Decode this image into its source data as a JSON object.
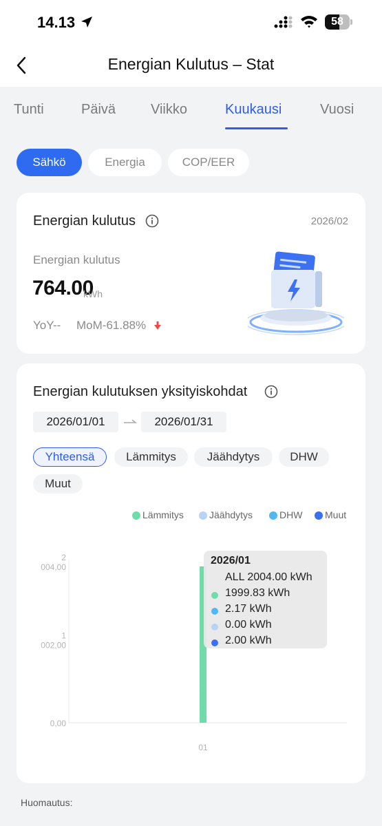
{
  "status_bar": {
    "time": "14.13",
    "battery": "58",
    "battery_level": 0.58
  },
  "navbar": {
    "title": "Energian Kulutus – Stat"
  },
  "tabs": [
    {
      "label": "Tunti",
      "active": false
    },
    {
      "label": "Päivä",
      "active": false
    },
    {
      "label": "Viikko",
      "active": false
    },
    {
      "label": "Kuukausi",
      "active": true
    },
    {
      "label": "Vuosi",
      "active": false
    }
  ],
  "type_chips": [
    {
      "label": "Sähkö",
      "active": true
    },
    {
      "label": "Energia",
      "active": false
    },
    {
      "label": "COP/EER",
      "active": false
    }
  ],
  "summary": {
    "title": "Energian kulutus",
    "date": "2026/02",
    "label": "Energian kulutus",
    "value": "764.00",
    "unit": "kWh",
    "yoy": "YoY--",
    "mom": "MoM-61.88%"
  },
  "details": {
    "title": "Energian kulutuksen yksityiskohdat",
    "date_start": "2026/01/01",
    "date_end": "2026/01/31",
    "filters": [
      {
        "label": "Yhteensä",
        "active": true
      },
      {
        "label": "Lämmitys",
        "active": false
      },
      {
        "label": "Jäähdytys",
        "active": false
      },
      {
        "label": "DHW",
        "active": false
      },
      {
        "label": "Muut",
        "active": false
      }
    ]
  },
  "colors": {
    "accent": "#2f5bea",
    "heating": "#6fdcaa",
    "cooling": "#b9d3f7",
    "dhw": "#4fb8f5",
    "other": "#3b6ff0"
  },
  "chart_data": {
    "type": "bar",
    "categories": [
      "01"
    ],
    "series": [
      {
        "name": "Lämmitys",
        "values": [
          1999.83
        ]
      },
      {
        "name": "Jäähdytys",
        "values": [
          0.0
        ]
      },
      {
        "name": "DHW",
        "values": [
          2.17
        ]
      },
      {
        "name": "Muut",
        "values": [
          2.0
        ]
      }
    ],
    "y_ticks": [
      "0,00",
      "1\n002,00",
      "2\n004,00"
    ],
    "ylim": [
      0,
      2004
    ],
    "legend_position": "top-right",
    "tooltip": {
      "title": "2026/01",
      "total": "ALL 2004.00 kWh",
      "rows": [
        {
          "text": "1999.83 kWh",
          "series": "Lämmitys"
        },
        {
          "text": "2.17 kWh",
          "series": "DHW"
        },
        {
          "text": "0.00 kWh",
          "series": "Jäähdytys"
        },
        {
          "text": "2.00 kWh",
          "series": "Muut"
        }
      ]
    }
  },
  "footer": {
    "note": "Huomautus:"
  }
}
